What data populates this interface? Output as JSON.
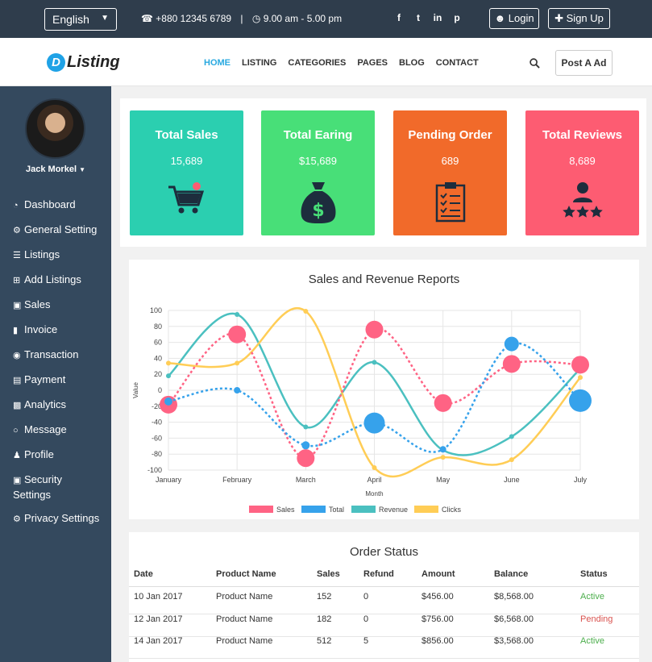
{
  "topbar": {
    "language": "English",
    "phone": "+880 12345 6789",
    "separator": "|",
    "hours": "9.00 am - 5.00 pm",
    "social": [
      "f",
      "t",
      "in",
      "p"
    ],
    "login": "Login",
    "signup": "Sign Up"
  },
  "header": {
    "logo_letter": "D",
    "logo_text": "Listing",
    "nav": [
      "HOME",
      "LISTING",
      "CATEGORIES",
      "PAGES",
      "BLOG",
      "CONTACT"
    ],
    "active_nav": "HOME",
    "post_ad": "Post A Ad"
  },
  "sidebar": {
    "user": "Jack Morkel",
    "items": [
      {
        "label": "Dashboard",
        "icon": "dashboard-icon"
      },
      {
        "label": "General Setting",
        "icon": "gear-icon"
      },
      {
        "label": "Listings",
        "icon": "list-icon"
      },
      {
        "label": "Add Listings",
        "icon": "plus-square-icon"
      },
      {
        "label": "Sales",
        "icon": "cart-icon"
      },
      {
        "label": "Invoice",
        "icon": "file-icon"
      },
      {
        "label": "Transaction",
        "icon": "money-icon"
      },
      {
        "label": "Payment",
        "icon": "credit-card-icon"
      },
      {
        "label": "Analytics",
        "icon": "bar-chart-icon"
      },
      {
        "label": "Message",
        "icon": "comment-icon"
      },
      {
        "label": "Profile",
        "icon": "user-icon"
      },
      {
        "label": "Security Settings",
        "icon": "lock-icon"
      },
      {
        "label": "Privacy Settings",
        "icon": "gear-icon"
      }
    ]
  },
  "cards": [
    {
      "title": "Total Sales",
      "value": "15,689",
      "color": "#2bcfb0",
      "icon": "shopping-cart-icon"
    },
    {
      "title": "Total Earing",
      "value": "$15,689",
      "color": "#48df78",
      "icon": "money-bag-icon"
    },
    {
      "title": "Pending Order",
      "value": "689",
      "color": "#f16a2a",
      "icon": "clipboard-icon"
    },
    {
      "title": "Total Reviews",
      "value": "8,689",
      "color": "#fd5c72",
      "icon": "user-stars-icon"
    }
  ],
  "chart_data": {
    "type": "line",
    "title": "Sales and Revenue Reports",
    "xlabel": "Month",
    "ylabel": "Value",
    "categories": [
      "January",
      "February",
      "March",
      "April",
      "May",
      "June",
      "July"
    ],
    "ylim": [
      -100,
      100
    ],
    "yticks": [
      100,
      80,
      60,
      40,
      20,
      0,
      -20,
      -40,
      -60,
      -80,
      -100
    ],
    "grid": true,
    "legend": "bottom",
    "series": [
      {
        "name": "Sales",
        "values": [
          -18,
          70,
          -85,
          76,
          -16,
          33,
          32
        ],
        "color": "#ff6384",
        "style": "dashed",
        "marker": "large"
      },
      {
        "name": "Total",
        "values": [
          -14,
          0,
          -69,
          -41,
          -74,
          58,
          -13
        ],
        "color": "#36a2eb",
        "style": "dashed",
        "marker": "varied"
      },
      {
        "name": "Revenue",
        "values": [
          18,
          95,
          -46,
          35,
          -75,
          -58,
          27
        ],
        "color": "#4bc0c0",
        "style": "solid",
        "marker": "small"
      },
      {
        "name": "Clicks",
        "values": [
          34,
          34,
          99,
          -97,
          -84,
          -87,
          16
        ],
        "color": "#ffcd56",
        "style": "solid",
        "marker": "small"
      }
    ]
  },
  "orders": {
    "title": "Order Status",
    "columns": [
      "Date",
      "Product Name",
      "Sales",
      "Refund",
      "Amount",
      "Balance",
      "Status"
    ],
    "rows": [
      [
        "10 Jan 2017",
        "Product Name",
        "152",
        "0",
        "$456.00",
        "$8,568.00",
        "Active"
      ],
      [
        "12 Jan 2017",
        "Product Name",
        "182",
        "0",
        "$756.00",
        "$6,568.00",
        "Pending"
      ],
      [
        "14 Jan 2017",
        "Product Name",
        "512",
        "5",
        "$856.00",
        "$3,568.00",
        "Active"
      ]
    ]
  }
}
